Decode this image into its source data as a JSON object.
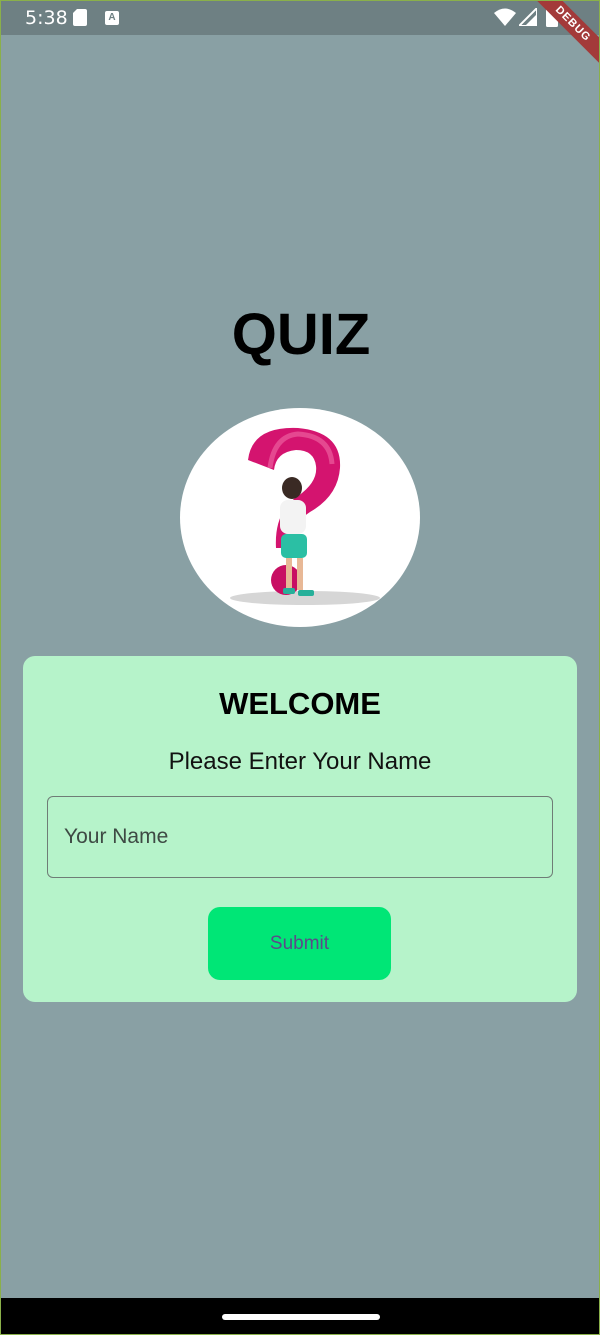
{
  "status_bar": {
    "time": "5:38",
    "icons": [
      "sd-card-icon",
      "a-icon",
      "wifi-icon",
      "signal-icon",
      "battery-icon"
    ],
    "a_icon_label": "A"
  },
  "debug_ribbon": {
    "label": "DEBUG"
  },
  "page": {
    "title": "QUIZ",
    "image": "question-mark-person-illustration"
  },
  "card": {
    "title": "WELCOME",
    "subtitle": "Please Enter Your Name",
    "name_input": {
      "placeholder": "Your Name",
      "value": ""
    },
    "submit_label": "Submit"
  },
  "colors": {
    "background": "#89a0a4",
    "card": "#b6f3ca",
    "submit_button": "#00e676",
    "submit_text": "#5b4a8a",
    "question_mark": "#d4146f"
  }
}
